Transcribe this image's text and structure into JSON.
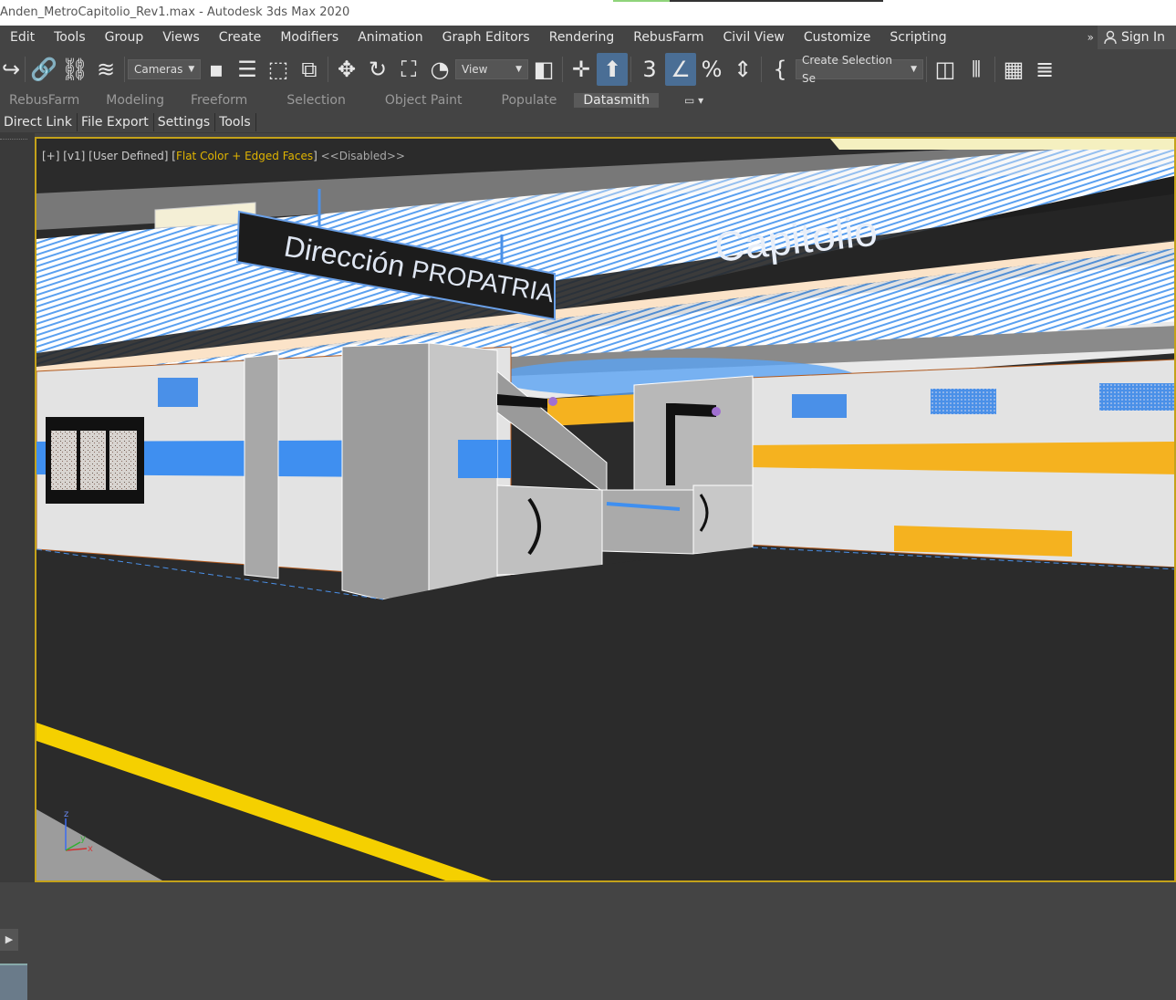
{
  "window": {
    "title": "Anden_MetroCapitolio_Rev1.max - Autodesk 3ds Max 2020"
  },
  "menu": {
    "items": [
      "Edit",
      "Tools",
      "Group",
      "Views",
      "Create",
      "Modifiers",
      "Animation",
      "Graph Editors",
      "Rendering",
      "RebusFarm",
      "Civil View",
      "Customize",
      "Scripting"
    ],
    "more": "»",
    "signin": "Sign In"
  },
  "toolbar": {
    "cameras_dropdown": "Cameras",
    "view_dropdown": "View",
    "selection_set_dropdown": "Create Selection Se",
    "icons": [
      "undo-icon",
      "link-icon",
      "unlink-icon",
      "bind-spacewarp-icon",
      "select-object-icon",
      "select-by-name-icon",
      "rect-select-icon",
      "window-crossing-icon",
      "move-icon",
      "rotate-icon",
      "scale-icon",
      "placement-icon",
      "pivot-icon",
      "snap-move-icon",
      "manipulate-icon",
      "snap-3d-icon",
      "angle-snap-icon",
      "percent-snap-icon",
      "spinner-snap-icon",
      "edit-named-selection-icon",
      "mirror-icon",
      "align-icon",
      "scene-explorer-icon",
      "layer-explorer-icon"
    ]
  },
  "ribbon": {
    "tabs": [
      "RebusFarm",
      "Modeling",
      "Freeform",
      "Selection",
      "Object Paint",
      "Populate",
      "Datasmith"
    ],
    "selected": "Datasmith"
  },
  "subbar": {
    "items": [
      "Direct Link",
      "File Export",
      "Settings",
      "Tools"
    ]
  },
  "viewport": {
    "label_prefix": "[+] [v1] [User Defined] [",
    "label_shading": "Flat Color + Edged Faces",
    "label_suffix": "]",
    "label_disabled": "<<Disabled>>",
    "signs": {
      "direction_line1": "Dirección",
      "direction_line2": "PROPATRIA",
      "station": "Capitolio"
    },
    "axis": {
      "x": "x",
      "y": "y",
      "z": "z"
    }
  },
  "colors": {
    "accent_blue": "#4a6e95",
    "floor_yellow": "#f5d000",
    "wall_blue": "#3f8ff0",
    "wall_orange": "#f5b21f",
    "viewport_border": "#c4a21a"
  }
}
